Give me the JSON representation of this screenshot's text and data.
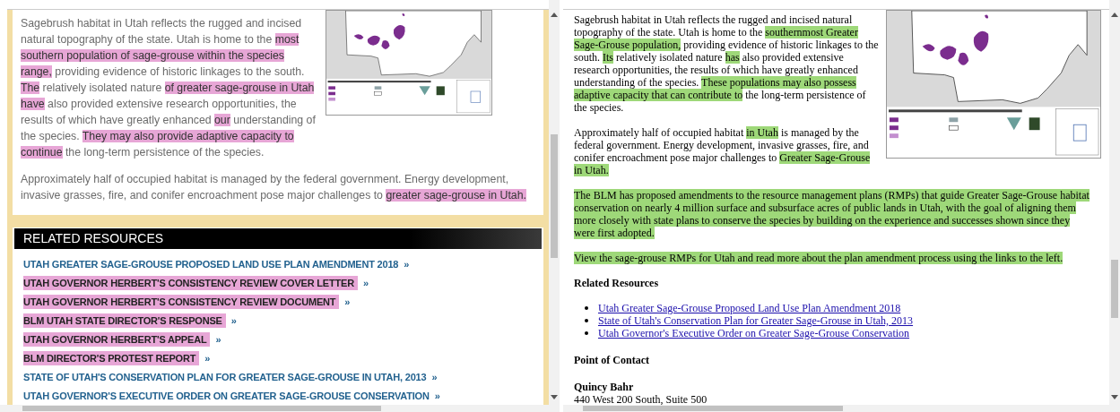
{
  "left_pane": {
    "intro_paragraphs": [
      {
        "segments": [
          {
            "text": "Sagebrush habitat in Utah reflects the rugged and incised natural topography of the state. Utah is home to the ",
            "highlighted": false
          },
          {
            "text": "most southern population of sage-grouse within the species range,",
            "highlighted": true
          },
          {
            "text": " providing evidence of historic linkages to the south. ",
            "highlighted": false
          },
          {
            "text": "The",
            "highlighted": true
          },
          {
            "text": " relatively isolated nature ",
            "highlighted": false
          },
          {
            "text": "of greater sage-grouse in Utah have",
            "highlighted": true
          },
          {
            "text": " also provided extensive research opportunities, the results of which have greatly enhanced ",
            "highlighted": false
          },
          {
            "text": "our",
            "highlighted": true
          },
          {
            "text": " understanding of the species. ",
            "highlighted": false
          },
          {
            "text": "They may also provide adaptive capacity to continue",
            "highlighted": true
          },
          {
            "text": " the long-term persistence of the species.",
            "highlighted": false
          }
        ]
      }
    ],
    "paragraphs": [
      {
        "segments": [
          {
            "text": "Approximately half of occupied habitat is managed by the federal government. Energy development, invasive grasses, fire, and conifer encroachment pose major challenges to ",
            "highlighted": false
          },
          {
            "text": "greater sage-grouse in Utah.",
            "highlighted": true
          }
        ]
      }
    ],
    "related_resources": {
      "heading": "RELATED RESOURCES",
      "links": [
        {
          "text": "UTAH GREATER SAGE-GROUSE PROPOSED LAND USE PLAN AMENDMENT 2018",
          "arrow": "»",
          "highlighted": false
        },
        {
          "text": "UTAH GOVERNOR HERBERT'S CONSISTENCY REVIEW COVER LETTER",
          "arrow": "»",
          "highlighted": true
        },
        {
          "text": "UTAH GOVERNOR HERBERT'S CONSISTENCY REVIEW DOCUMENT",
          "arrow": "»",
          "highlighted": true
        },
        {
          "text": "BLM UTAH STATE DIRECTOR'S RESPONSE",
          "arrow": "»",
          "highlighted": true
        },
        {
          "text": "UTAH GOVERNOR HERBERT'S APPEAL",
          "arrow": "»",
          "highlighted": true
        },
        {
          "text": "BLM DIRECTOR'S PROTEST REPORT",
          "arrow": "»",
          "highlighted": true
        },
        {
          "text": "STATE OF UTAH'S CONSERVATION PLAN FOR GREATER SAGE-GROUSE IN UTAH, 2013",
          "arrow": "»",
          "highlighted": false
        },
        {
          "text": "UTAH GOVERNOR'S EXECUTIVE ORDER ON GREATER SAGE-GROUSE CONSERVATION",
          "arrow": "»",
          "highlighted": false
        }
      ]
    }
  },
  "right_pane": {
    "intro_paragraphs": [
      {
        "segments": [
          {
            "text": "Sagebrush habitat in Utah reflects the rugged and incised natural topography of the state. Utah is home to the ",
            "highlighted": false
          },
          {
            "text": "southernmost Greater Sage-Grouse population,",
            "highlighted": true
          },
          {
            "text": " providing evidence of historic linkages to the south. ",
            "highlighted": false
          },
          {
            "text": "Its",
            "highlighted": true
          },
          {
            "text": " relatively isolated nature ",
            "highlighted": false
          },
          {
            "text": "has",
            "highlighted": true
          },
          {
            "text": " also provided extensive research opportunities, the results of which have greatly enhanced understanding of the species. ",
            "highlighted": false
          },
          {
            "text": "These populations may also possess adaptive capacity that can contribute to",
            "highlighted": true
          },
          {
            "text": " the long-term persistence of the species.",
            "highlighted": false
          }
        ]
      },
      {
        "segments": [
          {
            "text": "Approximately half of occupied habitat ",
            "highlighted": false
          },
          {
            "text": "in Utah",
            "highlighted": true
          },
          {
            "text": " is managed by the federal government. Energy development, invasive grasses, fire, and conifer encroachment pose major challenges to ",
            "highlighted": false
          },
          {
            "text": "Greater Sage-Grouse in Utah.",
            "highlighted": true
          }
        ]
      }
    ],
    "paragraphs": [
      {
        "segments": [
          {
            "text": "The BLM has proposed amendments to the resource management plans (RMPs) that guide Greater Sage-Grouse habitat conservation on nearly 4 million surface and subsurface acres of public lands in Utah, with the goal of aligning them more closely with state plans to conserve the species by building on the experience and successes shown since they were first adopted.",
            "highlighted": true
          }
        ]
      },
      {
        "segments": [
          {
            "text": "View the sage-grouse RMPs for Utah and read more about the plan amendment process using the links to the left.",
            "highlighted": true
          }
        ]
      }
    ],
    "related_resources": {
      "heading": "Related Resources",
      "links": [
        {
          "text": "Utah Greater Sage-Grouse Proposed Land Use Plan Amendment 2018"
        },
        {
          "text": "State of Utah's Conservation Plan for Greater Sage-Grouse in Utah, 2013"
        },
        {
          "text": "Utah Governor's Executive Order on Greater Sage-Grouse Conservation"
        }
      ]
    },
    "point_of_contact": {
      "heading": "Point of Contact",
      "name": "Quincy Bahr",
      "address": "440 West 200 South, Suite 500"
    }
  }
}
